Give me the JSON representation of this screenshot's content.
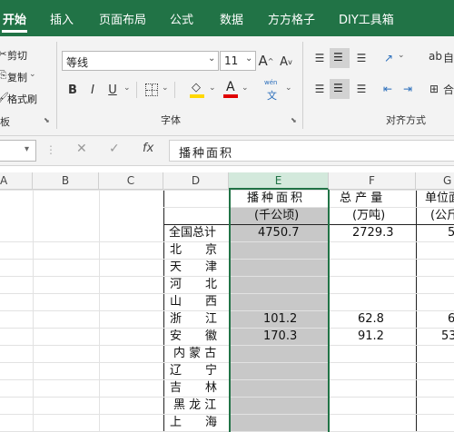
{
  "tabs": [
    "开始",
    "插入",
    "页面布局",
    "公式",
    "数据",
    "方方格子",
    "DIY工具箱"
  ],
  "clipboard": {
    "cut": "剪切",
    "copy": "复制",
    "format_painter": "格式刷",
    "group_label": "板"
  },
  "font": {
    "name": "等线",
    "size": "11",
    "group_label": "字体",
    "bold": "B",
    "italic": "I",
    "underline": "U",
    "grow": "A",
    "shrink": "A",
    "font_color_letter": "A",
    "phonetic_top": "wén",
    "phonetic_bottom": "文",
    "highlight_color": "#ffd800",
    "font_color": "#e00000"
  },
  "alignment": {
    "group_label": "对齐方式",
    "wrap_partial": "ab",
    "wrap_partial_right": "自",
    "merge_partial": "合"
  },
  "formula_bar": {
    "name_box": "",
    "fx": "fx",
    "cancel": "✕",
    "confirm": "✓",
    "content": "播种面积"
  },
  "columns": [
    "A",
    "B",
    "C",
    "D",
    "E",
    "F",
    "G"
  ],
  "header_row1": {
    "E": "播种面积",
    "F": "总 产 量",
    "G": "单位面"
  },
  "header_row2": {
    "E": "(千公顷)",
    "F": "(万吨)",
    "G": "(公斤"
  },
  "rows": [
    {
      "D": "全国总计",
      "E": "4750.7",
      "F": "2729.3",
      "G": "5"
    },
    {
      "D": "北　　京",
      "E": "",
      "F": "",
      "G": ""
    },
    {
      "D": "天　　津",
      "E": "",
      "F": "",
      "G": ""
    },
    {
      "D": "河　　北",
      "E": "",
      "F": "",
      "G": ""
    },
    {
      "D": "山　　西",
      "E": "",
      "F": "",
      "G": ""
    },
    {
      "D": "浙　　江",
      "E": "101.2",
      "F": "62.8",
      "G": "6"
    },
    {
      "D": "安　　徽",
      "E": "170.3",
      "F": "91.2",
      "G": "53"
    },
    {
      "D": "内 蒙 古",
      "E": "",
      "F": "",
      "G": ""
    },
    {
      "D": "辽　　宁",
      "E": "",
      "F": "",
      "G": ""
    },
    {
      "D": "吉　　林",
      "E": "",
      "F": "",
      "G": ""
    },
    {
      "D": "黑 龙 江",
      "E": "",
      "F": "",
      "G": ""
    },
    {
      "D": "上　　海",
      "E": "",
      "F": "",
      "G": ""
    }
  ],
  "colors": {
    "accent": "#217346",
    "selected_fill": "#c8c8c8",
    "selected_header": "#d3e9dc"
  }
}
